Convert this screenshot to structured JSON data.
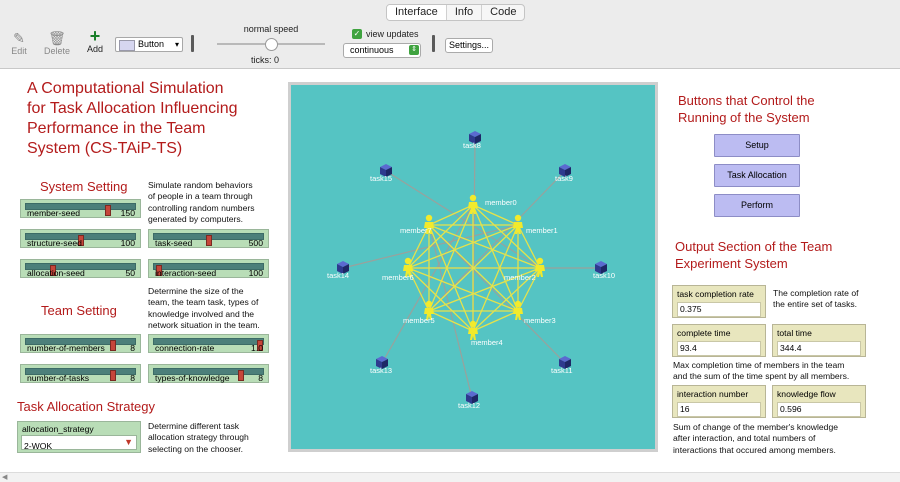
{
  "tabs": [
    "Interface",
    "Info",
    "Code"
  ],
  "toolbar": {
    "edit_label": "Edit",
    "delete_label": "Delete",
    "add_label": "Add",
    "widget_type": "Button",
    "speed_label": "normal speed",
    "ticks_label": "ticks: 0",
    "view_updates_label": "view updates",
    "update_mode": "continuous",
    "settings_label": "Settings..."
  },
  "left": {
    "title": "A Computational Simulation for Task Allocation Influencing Performance in the Team System (CS-TAiP-TS)",
    "title_lines": [
      "A Computational Simulation",
      "for Task Allocation Influencing",
      "Performance in the Team",
      "System (CS-TAiP-TS)"
    ],
    "system_setting": "System Setting",
    "system_desc_lines": [
      "Simulate random behaviors",
      "of people in a team through",
      "controlling random numbers",
      "generated by computers."
    ],
    "team_setting": "Team Setting",
    "team_desc_lines": [
      "Determine the size of the",
      "team, the team task, types of",
      "knowledge involved and the",
      "network situation in the team."
    ],
    "strategy_title": "Task Allocation Strategy",
    "strategy_desc_lines": [
      "Determine different task",
      "allocation strategy through",
      "selecting on the chooser."
    ],
    "chooser_label": "allocation_strategy",
    "chooser_value": "2-WOK"
  },
  "sliders": [
    {
      "label": "member-seed",
      "value": "150",
      "fraction": 0.75
    },
    {
      "label": "structure-seed",
      "value": "100",
      "fraction": 0.5
    },
    {
      "label": "task-seed",
      "value": "500",
      "fraction": 0.5
    },
    {
      "label": "allocation-seed",
      "value": "50",
      "fraction": 0.25
    },
    {
      "label": "interaction-seed",
      "value": "100",
      "fraction": 0.05
    },
    {
      "label": "number-of-members",
      "value": "8",
      "fraction": 0.8
    },
    {
      "label": "connection-rate",
      "value": "1.0",
      "fraction": 1.0
    },
    {
      "label": "number-of-tasks",
      "value": "8",
      "fraction": 0.8
    },
    {
      "label": "types-of-knowledge",
      "value": "8",
      "fraction": 0.8
    }
  ],
  "view": {
    "members": [
      "member0",
      "member1",
      "member2",
      "member3",
      "member4",
      "member5",
      "member6",
      "member7"
    ],
    "tasks": [
      "task8",
      "task9",
      "task10",
      "task11",
      "task12",
      "task13",
      "task14",
      "task15"
    ]
  },
  "right": {
    "buttons_title_lines": [
      "Buttons that Control the",
      "Running of the System"
    ],
    "buttons": [
      "Setup",
      "Task Allocation",
      "Perform"
    ],
    "output_title_lines": [
      "Output Section of the Team",
      "Experiment System"
    ],
    "monitors": [
      {
        "label": "task completion rate",
        "value": "0.375"
      },
      {
        "label": "complete time",
        "value": "93.4"
      },
      {
        "label": "total time",
        "value": "344.4"
      },
      {
        "label": "interaction number",
        "value": "16"
      },
      {
        "label": "knowledge flow",
        "value": "0.596"
      }
    ],
    "note1_lines": [
      "The completion rate of",
      "the entire set of tasks."
    ],
    "note2_lines": [
      "Max completion time of members in the team",
      "and the sum of the time spent by all members."
    ],
    "note3_lines": [
      "Sum of change of the member's knowledge",
      "after interaction, and total numbers of",
      "interactions that occured among members."
    ]
  },
  "colors": {
    "view_bg": "#55c4c3",
    "title_red": "#b31b1b",
    "member": "#f2ea2c",
    "task": "#2e3a8e",
    "edge_yellow": "#e6e24a",
    "edge_gray": "#9aa19c"
  }
}
